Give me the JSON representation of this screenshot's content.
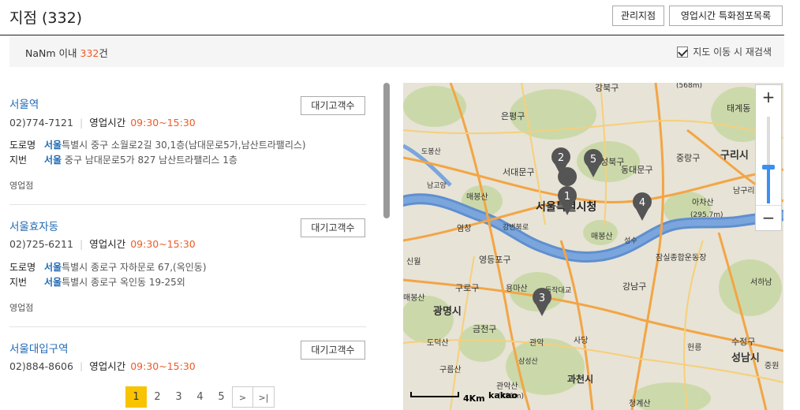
{
  "header": {
    "title": "지점 (332)",
    "manage_button": "관리지점",
    "special_button": "영업시간 특화점포목록"
  },
  "summary": {
    "range": "NaNm 이내",
    "count": "332",
    "unit": "건",
    "research_label": "지도 이동 시 재검색",
    "research_checked": true
  },
  "branches": [
    {
      "name_hl": "서울",
      "name_rest": "역",
      "phone": "02)774-7121",
      "hours_label": "영업시간",
      "hours": "09:30~15:30",
      "wait_button": "대기고객수",
      "road_label": "도로명",
      "road_hl": "서울",
      "road_rest": "특별시 중구 소월로2길 30,1층(남대문로5가,남산트라팰리스)",
      "lot_label": "지번",
      "lot_hl": "서울",
      "lot_rest": " 중구 남대문로5가 827 남산트라팰리스 1층",
      "type": "영업점"
    },
    {
      "name_hl": "서울",
      "name_rest": "효자동",
      "phone": "02)725-6211",
      "hours_label": "영업시간",
      "hours": "09:30~15:30",
      "wait_button": "대기고객수",
      "road_label": "도로명",
      "road_hl": "서울",
      "road_rest": "특별시 종로구 자하문로 67,(옥인동)",
      "lot_label": "지번",
      "lot_hl": "서울",
      "lot_rest": "특별시 종로구 옥인동 19-25외",
      "type": "영업점"
    },
    {
      "name_hl": "서울",
      "name_rest": "대입구역",
      "phone": "02)884-8606",
      "hours_label": "영업시간",
      "hours": "09:30~15:30",
      "wait_button": "대기고객수"
    }
  ],
  "pagination": {
    "pages": [
      "1",
      "2",
      "3",
      "4",
      "5"
    ],
    "current": "1",
    "next": ">",
    "last": ">|"
  },
  "map": {
    "places": [
      {
        "text": "강북구"
      },
      {
        "text": "(568m)"
      },
      {
        "text": "은평구"
      },
      {
        "text": "도봉산"
      },
      {
        "text": "태계동"
      },
      {
        "text": "성북구"
      },
      {
        "text": "서대문구"
      },
      {
        "text": "동대문구"
      },
      {
        "text": "중랑구"
      },
      {
        "text": "구리시"
      },
      {
        "text": "남고양"
      },
      {
        "text": "매봉산"
      },
      {
        "text": "서울특별시청"
      },
      {
        "text": "아차산"
      },
      {
        "text": "(295.7m)"
      },
      {
        "text": "남구리"
      },
      {
        "text": "염창"
      },
      {
        "text": "강변북로"
      },
      {
        "text": "매봉산"
      },
      {
        "text": "성수"
      },
      {
        "text": "신월"
      },
      {
        "text": "영등포구"
      },
      {
        "text": "잠실종합운동장"
      },
      {
        "text": "구로구"
      },
      {
        "text": "용마산"
      },
      {
        "text": "동작대교"
      },
      {
        "text": "강남구"
      },
      {
        "text": "서하남"
      },
      {
        "text": "매봉산"
      },
      {
        "text": "광명시"
      },
      {
        "text": "금천구"
      },
      {
        "text": "관악"
      },
      {
        "text": "사당"
      },
      {
        "text": "도덕산"
      },
      {
        "text": "구름산"
      },
      {
        "text": "관악산"
      },
      {
        "text": "(481m)"
      },
      {
        "text": "과천시"
      },
      {
        "text": "수정구"
      },
      {
        "text": "성남시"
      },
      {
        "text": "헌릉"
      },
      {
        "text": "중원"
      },
      {
        "text": "청계산"
      },
      {
        "text": "삼성산"
      }
    ],
    "markers": [
      "1",
      "2",
      "3",
      "4",
      "5"
    ],
    "scale_label": "4Km",
    "logo": "kakao",
    "zoom_in": "+",
    "zoom_out": "−"
  }
}
